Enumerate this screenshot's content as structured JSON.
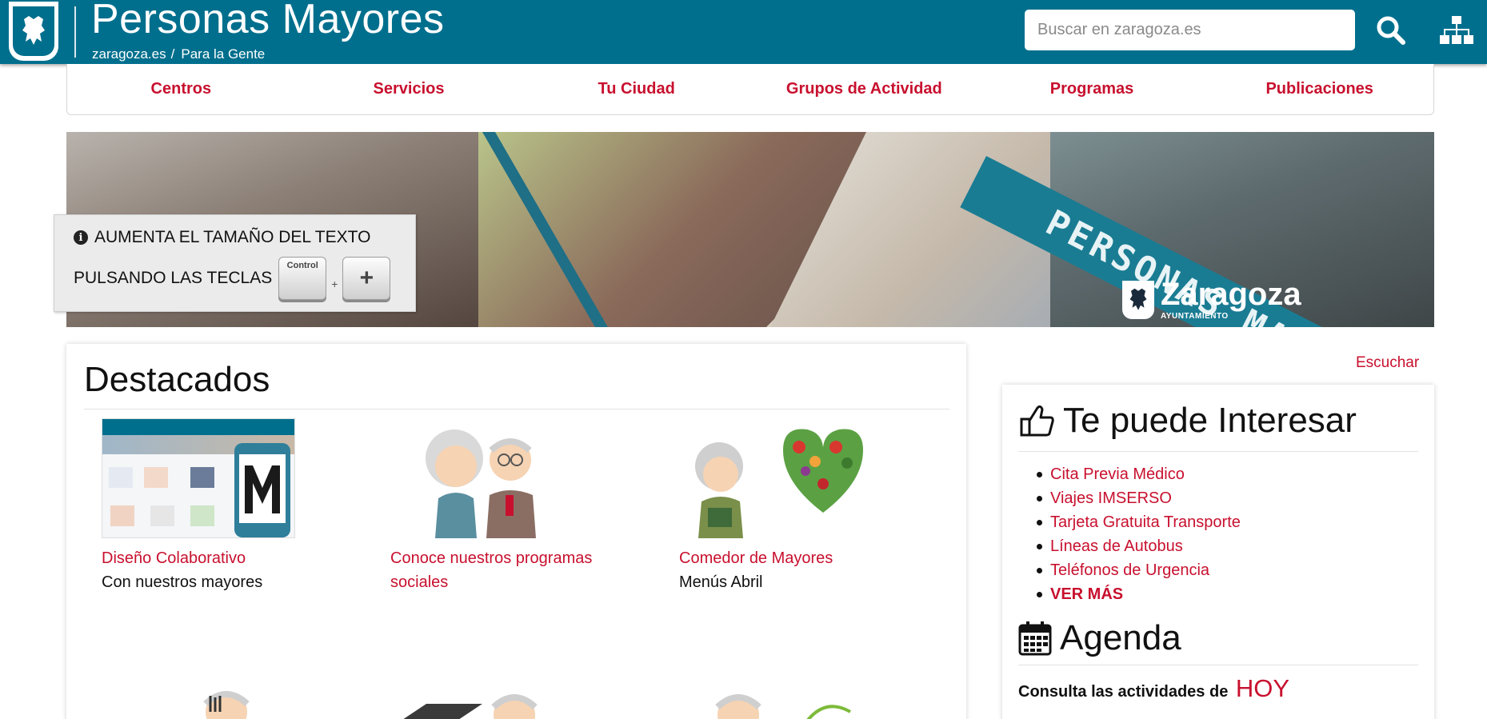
{
  "header": {
    "title": "Personas Mayores",
    "breadcrumb": [
      "zaragoza.es",
      "Para la Gente"
    ],
    "breadcrumb_sep": "/",
    "search_placeholder": "Buscar en zaragoza.es",
    "brand_color": "#006f8d",
    "icons": {
      "logo": "zaragoza-lion-shield-icon",
      "search": "search-icon",
      "sitemap": "sitemap-icon"
    }
  },
  "nav": {
    "items": [
      {
        "label": "Centros"
      },
      {
        "label": "Servicios"
      },
      {
        "label": "Tu Ciudad"
      },
      {
        "label": "Grupos de Actividad"
      },
      {
        "label": "Programas"
      },
      {
        "label": "Publicaciones"
      }
    ],
    "color": "#c8102e"
  },
  "banner": {
    "ribbon_text": "PERSONAS MAYORES",
    "brand_name": "Zaragoza",
    "brand_sub": "AYUNTAMIENTO"
  },
  "hint": {
    "line1": "AUMENTA EL TAMAÑO DEL TEXTO",
    "line2": "PULSANDO LAS TECLAS",
    "key_ctrl": "Control",
    "plus_sign": "+",
    "key_plus": "+"
  },
  "listen": "Escuchar",
  "destacados": {
    "title": "Destacados",
    "items": [
      {
        "link": "Diseño Colaborativo",
        "desc": "Con nuestros mayores",
        "thumb": "website-preview-m-logo"
      },
      {
        "link": "Conoce nuestros programas sociales",
        "desc": "",
        "thumb": "elderly-couple-illustration"
      },
      {
        "link": "Comedor de Mayores",
        "desc": "Menús Abril",
        "thumb": "grandmother-vegetable-heart-illustration"
      }
    ]
  },
  "sidebar": {
    "interest_title": "Te puede Interesar",
    "interest_items": [
      {
        "label": "Cita Previa Médico"
      },
      {
        "label": "Viajes IMSERSO"
      },
      {
        "label": "Tarjeta Gratuita Transporte"
      },
      {
        "label": "Líneas de Autobus"
      },
      {
        "label": "Teléfonos de Urgencia"
      },
      {
        "label": "VER MÁS"
      }
    ],
    "agenda_title": "Agenda",
    "consulta_text": "Consulta las actividades de",
    "consulta_hoy": "HOY"
  }
}
